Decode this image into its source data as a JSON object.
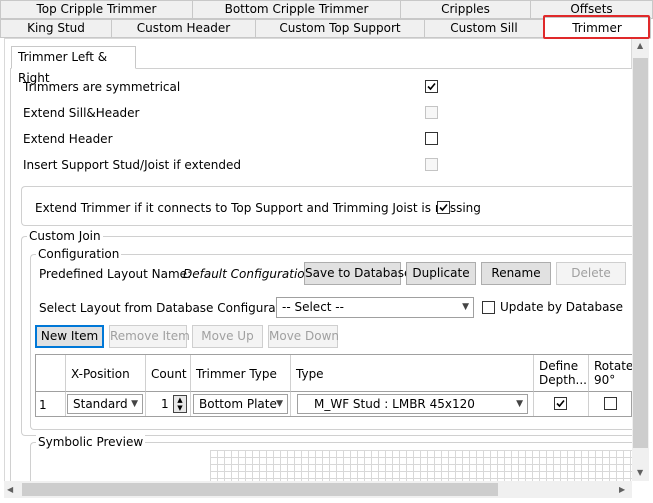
{
  "tabs": {
    "row1": [
      "Top Cripple Trimmer",
      "Bottom Cripple Trimmer",
      "Cripples",
      "Offsets"
    ],
    "row2": [
      "King Stud",
      "Custom Header",
      "Custom Top Support",
      "Custom Sill",
      "Trimmer"
    ],
    "active": "Trimmer"
  },
  "subtab": "Trimmer Left & Right",
  "options": [
    {
      "label": "Trimmers are symmetrical",
      "checked": true,
      "enabled": true
    },
    {
      "label": "Extend Sill&Header",
      "checked": false,
      "enabled": false
    },
    {
      "label": "Extend Header",
      "checked": false,
      "enabled": true
    },
    {
      "label": "Insert Support Stud/Joist if extended",
      "checked": false,
      "enabled": false
    }
  ],
  "extend_trimmer": {
    "label": "Extend Trimmer if it connects to Top Support and Trimming Joist is missing",
    "checked": true
  },
  "custom_join": {
    "title": "Custom Join",
    "configuration_title": "Configuration",
    "predefined_label": "Predefined Layout Name:",
    "predefined_value": "Default Configuration",
    "buttons": {
      "save": "Save to Database",
      "duplicate": "Duplicate",
      "rename": "Rename",
      "delete": "Delete"
    },
    "select_label": "Select Layout from Database Configuration:",
    "select_value": "-- Select --",
    "update_label": "Update by Database",
    "update_checked": false
  },
  "item_buttons": {
    "new": "New Item",
    "remove": "Remove Item",
    "up": "Move Up",
    "down": "Move Down"
  },
  "grid": {
    "headers": [
      "X-Position",
      "Count",
      "Trimmer Type",
      "Type",
      "Define Depth...",
      "Rotate 90°"
    ],
    "rows": [
      {
        "index": "1",
        "x_position": "Standard",
        "count": "1",
        "trimmer_type": "Bottom Plate",
        "type": "M_WF Stud : LMBR 45x120",
        "define_depth": true,
        "rotate": false
      }
    ]
  },
  "symbolic_preview": "Symbolic Preview",
  "colors": {
    "highlight": "#e0292a",
    "focus": "#0078d7"
  }
}
